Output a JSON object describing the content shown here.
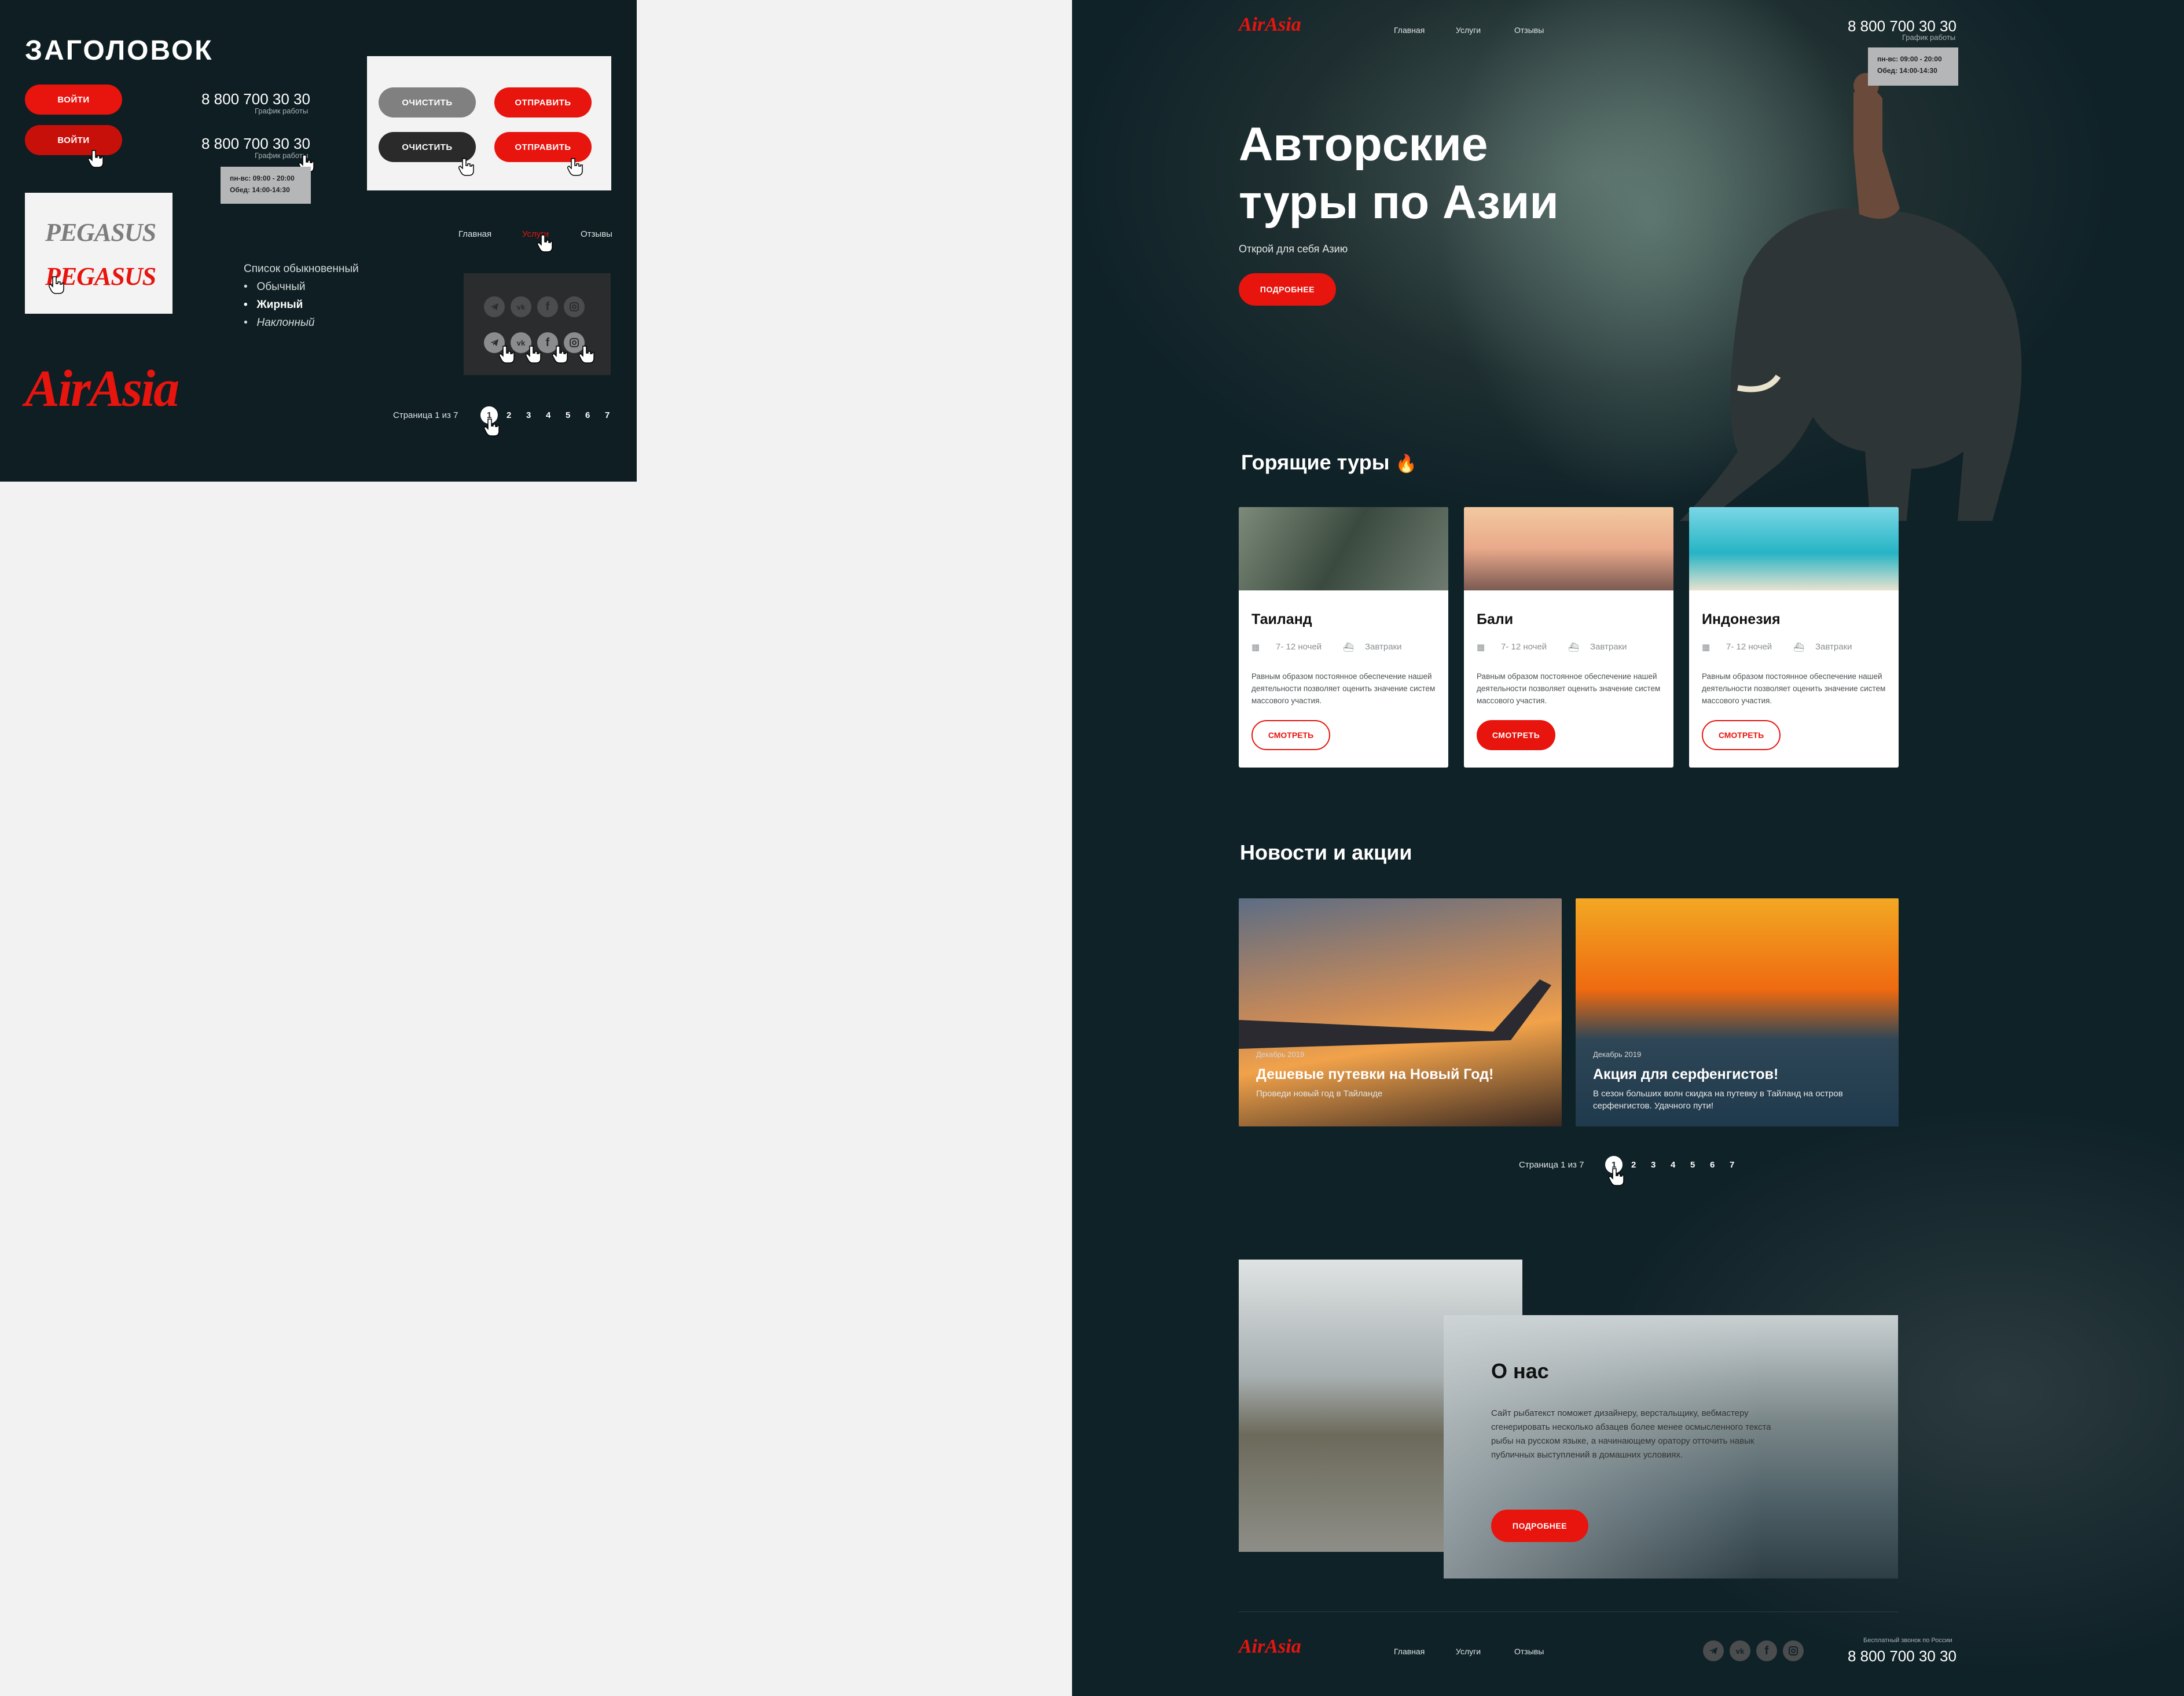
{
  "kit": {
    "title": "ЗАГОЛОВОК",
    "login_btn": "ВОЙТИ",
    "login_btn_hover": "ВОЙТИ",
    "phone": "8 800 700 30 30",
    "phone_hover": "8 800 700 30 30",
    "schedule_label": "График работы",
    "schedule_label_hover": "График работы",
    "tooltip_line1": "пн-вс: 09:00 - 20:00",
    "tooltip_line2": "Обед: 14:00-14:30",
    "clear_btn": "ОЧИСТИТЬ",
    "clear_btn_hover": "ОЧИСТИТЬ",
    "send_btn": "ОТПРАВИТЬ",
    "send_btn_hover": "ОТПРАВИТЬ",
    "logo_pegasus": "PEGASUS",
    "logo_pegasus_hover": "PEGASUS",
    "nav": [
      "Главная",
      "Услуги",
      "Отзывы"
    ],
    "list_caption": "Список обыкновенный",
    "list_items": [
      "Обычный",
      "Жирный",
      "Наклонный"
    ],
    "brand_logo": "AirAsia",
    "pager_label": "Страница 1 из 7",
    "pages": [
      "1",
      "2",
      "3",
      "4",
      "5",
      "6",
      "7"
    ]
  },
  "site": {
    "logo": "AirAsia",
    "nav": [
      "Главная",
      "Услуги",
      "Отзывы"
    ],
    "phone": "8 800 700 30 30",
    "schedule_label": "График работы",
    "tooltip_line1": "пн-вс: 09:00 - 20:00",
    "tooltip_line2": "Обед: 14:00-14:30",
    "hero_line1": "Авторские",
    "hero_line2": "туры по Азии",
    "hero_sub": "Открой для себя Азию",
    "hero_btn": "ПОДРОБНЕЕ",
    "hot_title": "Горящие туры",
    "tours": [
      {
        "title": "Таиланд",
        "nights": "7- 12 ночей",
        "food": "Завтраки",
        "desc": "Равным образом постоянное обеспечение нашей деятельности позволяет оценить значение систем массового участия.",
        "btn": "СМОТРЕТЬ"
      },
      {
        "title": "Бали",
        "nights": "7- 12 ночей",
        "food": "Завтраки",
        "desc": "Равным образом постоянное обеспечение нашей деятельности позволяет оценить значение систем массового участия.",
        "btn": "СМОТРЕТЬ"
      },
      {
        "title": "Индонезия",
        "nights": "7- 12 ночей",
        "food": "Завтраки",
        "desc": "Равным образом постоянное обеспечение нашей деятельности позволяет оценить значение систем массового участия.",
        "btn": "СМОТРЕТЬ"
      }
    ],
    "news_title": "Новости и акции",
    "news": [
      {
        "date": "Декабрь 2019",
        "title": "Дешевые путевки на Новый Год!",
        "sub": "Проведи новый год в Тайланде"
      },
      {
        "date": "Декабрь 2019",
        "title": "Акция для серфенгистов!",
        "sub": "В сезон больших волн скидка на путевку в Тайланд на остров серфенгистов. Удачного пути!"
      }
    ],
    "pager_label": "Страница 1 из 7",
    "pages": [
      "1",
      "2",
      "3",
      "4",
      "5",
      "6",
      "7"
    ],
    "about_title": "О нас",
    "about_text": "Сайт рыбатекст поможет дизайнеру, верстальщику, вебмастеру сгенерировать несколько абзацев более менее осмысленного текста рыбы на русском языке, а начинающему оратору отточить навык публичных выступлений в домашних условиях.",
    "about_btn": "ПОДРОБНЕЕ",
    "footer_nav": [
      "Главная",
      "Услуги",
      "Отзывы"
    ],
    "footer_free_call": "Бесплатный звонок по России",
    "footer_phone": "8 800 700 30 30"
  },
  "colors": {
    "accent": "#e8140e",
    "bg_dark": "#0e1e23",
    "page_bg": "#f2f2f2"
  }
}
